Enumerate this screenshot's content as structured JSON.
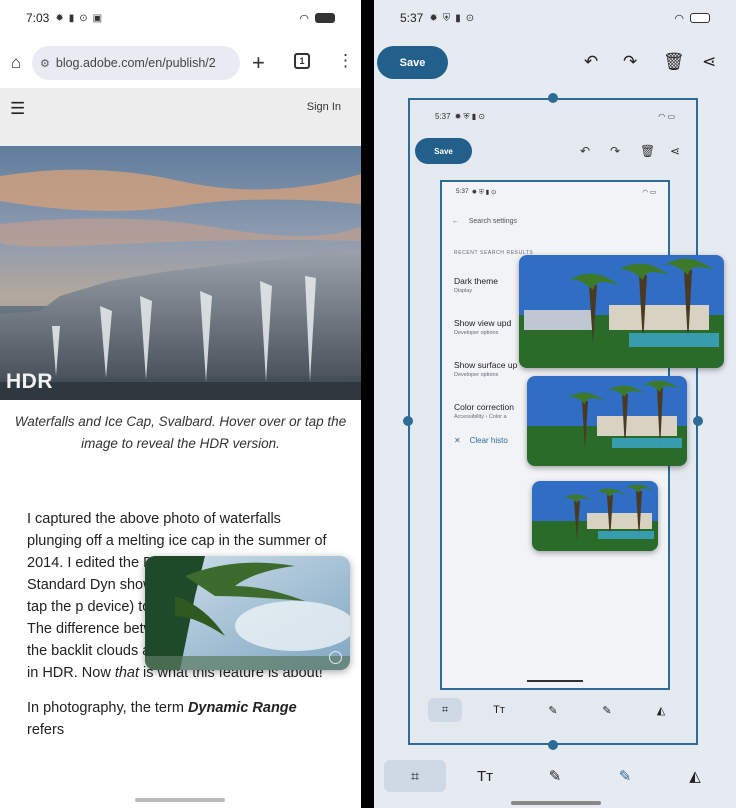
{
  "left": {
    "status": {
      "time": "7:03"
    },
    "url": "blog.adobe.com/en/publish/2",
    "site": {
      "signin": "Sign In"
    },
    "hero": {
      "label": "HDR"
    },
    "caption": "Waterfalls and Ice Cap, Svalbard. Hover over or tap the image to reveal the HDR version.",
    "article": {
      "p1": "I captured the above photo of waterfalls plunging off a melting ice cap in the summer of 2014. I edited the Dynamic Range (H The Standard Dyn shown by default – image (or tap the p device) to show the HDR version. The difference between the two is dramatic: the backlit clouds and waterfalls spring to life in HDR. Now ",
      "p1_em": "that",
      "p1_end": " is what this feature is about!",
      "p2_start": "In photography, the term ",
      "p2_strong": "Dynamic Range",
      "p2_end": " refers"
    }
  },
  "right": {
    "status": {
      "time": "5:37"
    },
    "save_label": "Save",
    "nested": {
      "time": "5:37",
      "save_label": "Save",
      "inner_time": "5:37",
      "search_placeholder": "Search settings",
      "section": "RECENT SEARCH RESULTS",
      "settings": [
        {
          "title": "Dark theme",
          "sub": "Display"
        },
        {
          "title": "Show view upd",
          "sub": "Developer options"
        },
        {
          "title": "Show surface up",
          "sub": "Developer options"
        },
        {
          "title": "Color correction",
          "sub": "Accessibility › Color a"
        }
      ],
      "clear_history": "Clear histo"
    },
    "toolbar": {
      "text_tool": "Tт"
    }
  },
  "colors": {
    "accent": "#235f8b",
    "frame": "#2e6c98",
    "editor_bg": "#e6eaf1"
  }
}
